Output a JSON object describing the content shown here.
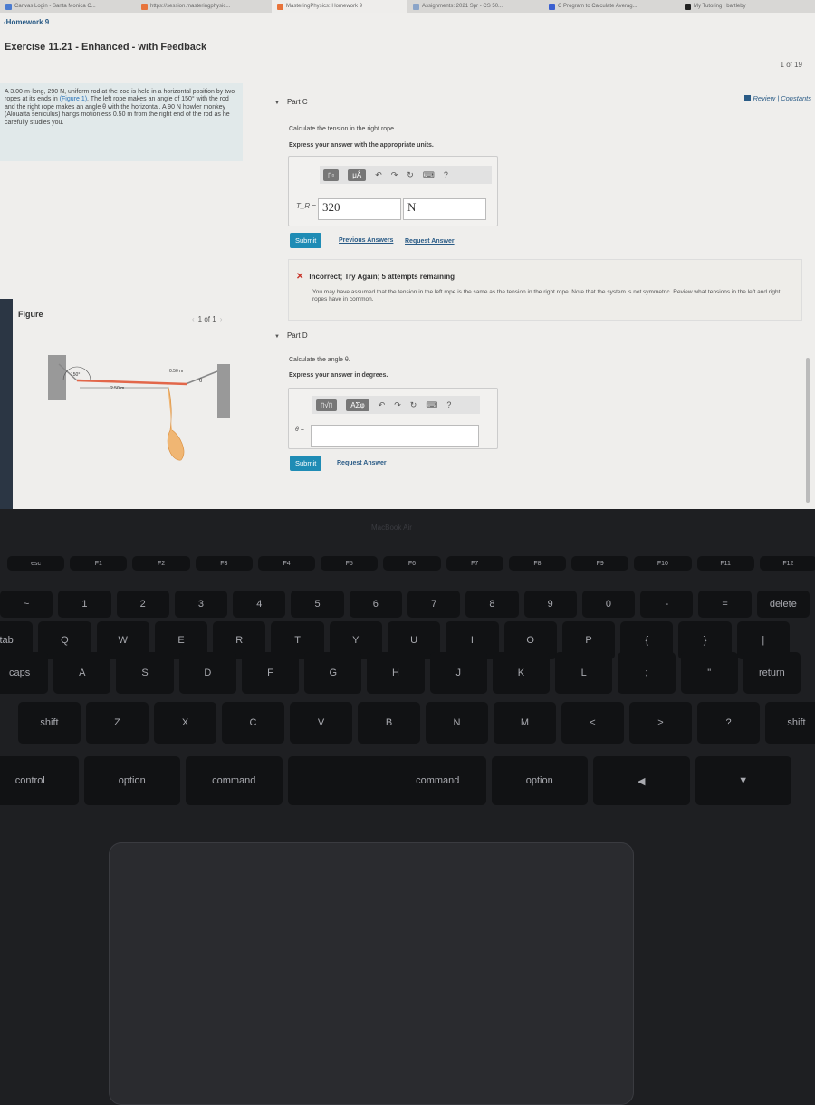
{
  "browser": {
    "tabs": [
      {
        "title": "Canvas Login - Santa Monica C..."
      },
      {
        "title": "https://session.masteringphysic..."
      },
      {
        "title": "MasteringPhysics: Homework 9",
        "active": true
      },
      {
        "title": "Assignments: 2021 Spr - CS 50..."
      },
      {
        "title": "C Program to Calculate Averag..."
      },
      {
        "title": "My Tutoring | bartleby"
      }
    ]
  },
  "header": {
    "back_link": "‹Homework 9",
    "exercise_title": "Exercise 11.21 - Enhanced - with Feedback",
    "pager": "1 of 19",
    "review_link": "Review | Constants"
  },
  "problem": {
    "text_before": "A 3.00-m-long, 290 N, uniform rod at the zoo is held in a horizontal position by two ropes at its ends in ",
    "figure_link": "(Figure 1)",
    "text_after": ". The left rope makes an angle of 150° with the rod and the right rope makes an angle θ with the horizontal. A 90 N howler monkey (Alouatta seniculus) hangs motionless 0.50 m from the right end of the rod as he carefully studies you."
  },
  "figure": {
    "label": "Figure",
    "pager": "1 of 1",
    "angle_left": "150°",
    "dist_right": "0.50 m",
    "dist_main": "2.50 m",
    "angle_right": "θ"
  },
  "part_c": {
    "title": "Part C",
    "prompt": "Calculate the tension in the right rope.",
    "instruction": "Express your answer with the appropriate units.",
    "toolbar": {
      "templates": "▯▫",
      "units": "μÅ",
      "help": "?"
    },
    "variable": "T_R =",
    "value": "320",
    "unit": "N",
    "submit": "Submit",
    "previous_answers": "Previous Answers",
    "request_answer": "Request Answer",
    "feedback": {
      "status": "Incorrect; Try Again; 5 attempts remaining",
      "message": "You may have assumed that the tension in the left rope is the same as the tension in the right rope. Note that the system is not symmetric. Review what tensions in the left and right ropes have in common."
    }
  },
  "part_d": {
    "title": "Part D",
    "prompt": "Calculate the angle θ.",
    "instruction": "Express your answer in degrees.",
    "toolbar": {
      "templates": "▯√▯",
      "symbols": "ΑΣφ",
      "help": "?"
    },
    "variable": "θ =",
    "value": "",
    "submit": "Submit",
    "request_answer": "Request Answer"
  },
  "laptop": {
    "brand": "MacBook Air",
    "keyboard": {
      "fn_row": [
        "esc",
        "F1",
        "F2",
        "F3",
        "F4",
        "F5",
        "F6",
        "F7",
        "F8",
        "F9",
        "F10",
        "F11",
        "F12"
      ],
      "num_row": [
        "~",
        "1",
        "2",
        "3",
        "4",
        "5",
        "6",
        "7",
        "8",
        "9",
        "0",
        "-",
        "=",
        "delete"
      ],
      "q_row": [
        "tab",
        "Q",
        "W",
        "E",
        "R",
        "T",
        "Y",
        "U",
        "I",
        "O",
        "P",
        "{",
        "}",
        "|"
      ],
      "a_row": [
        "caps",
        "A",
        "S",
        "D",
        "F",
        "G",
        "H",
        "J",
        "K",
        "L",
        ";",
        "\"",
        "return"
      ],
      "z_row": [
        "shift",
        "Z",
        "X",
        "C",
        "V",
        "B",
        "N",
        "M",
        "<",
        ">",
        "?",
        "shift"
      ],
      "bottom_row": [
        "control",
        "option",
        "command",
        "",
        "command",
        "option",
        "◀",
        "▼"
      ]
    }
  }
}
